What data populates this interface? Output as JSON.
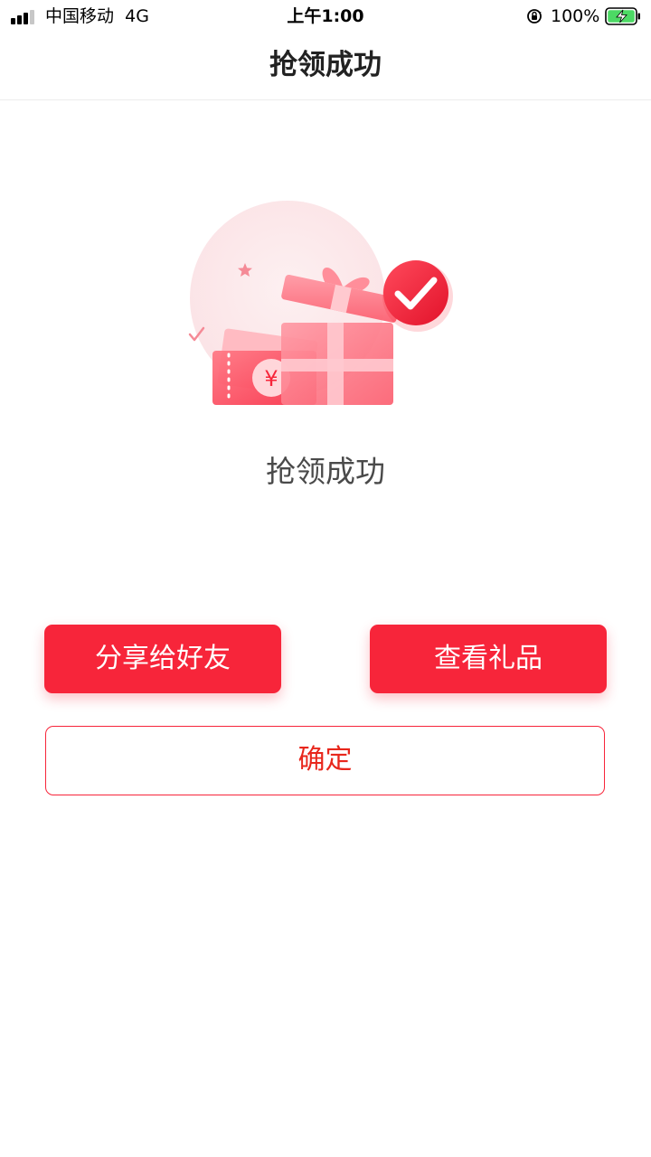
{
  "status_bar": {
    "carrier": "中国移动",
    "network": "4G",
    "time": "上午1:00",
    "battery_percent": "100%"
  },
  "header": {
    "title": "抢领成功"
  },
  "result": {
    "message": "抢领成功"
  },
  "illustration": {
    "currency_symbol": "¥"
  },
  "actions": {
    "share_label": "分享给好友",
    "view_gift_label": "查看礼品",
    "confirm_label": "确定"
  },
  "colors": {
    "accent": "#f7253a",
    "confirm_text": "#e8271c",
    "battery_fill": "#4cd964"
  }
}
